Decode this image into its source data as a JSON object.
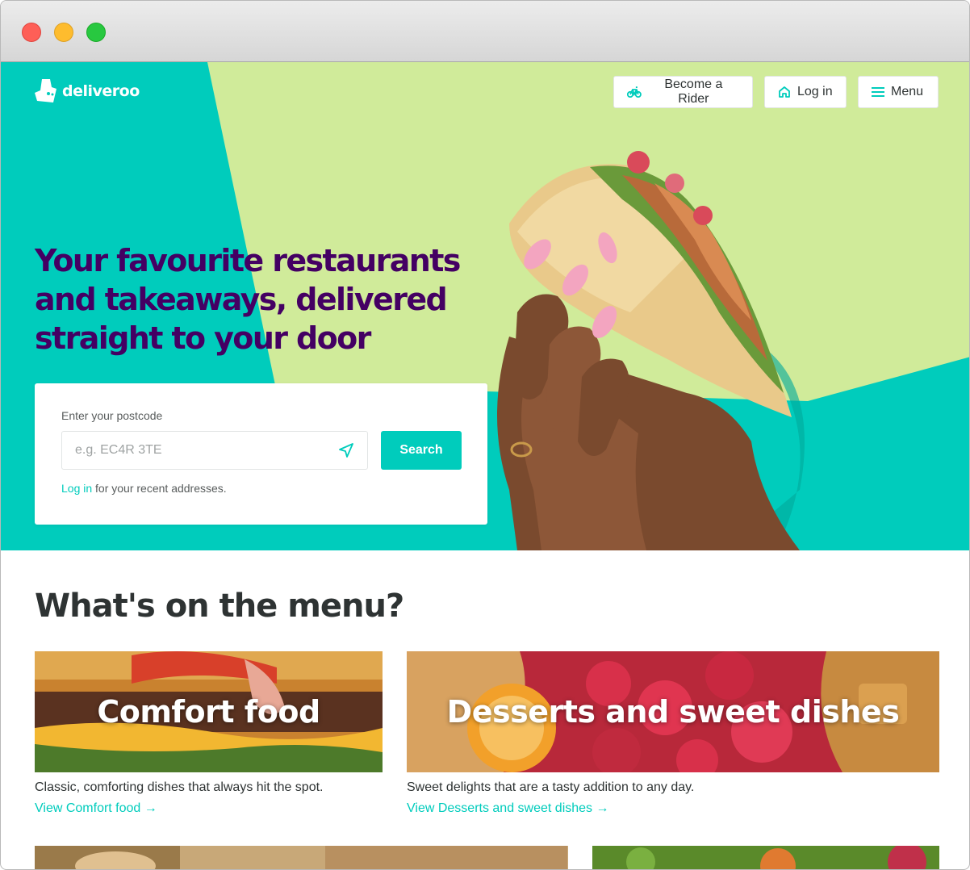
{
  "brand": {
    "name": "deliveroo",
    "teal": "#00ccbc",
    "purple": "#440063",
    "lime": "#d0eb9a"
  },
  "nav": {
    "rider_label": "Become a Rider",
    "login_label": "Log in",
    "menu_label": "Menu"
  },
  "hero": {
    "headline": "Your favourite restaurants and takeaways, delivered straight to your door",
    "search": {
      "label": "Enter your postcode",
      "placeholder": "e.g. EC4R 3TE",
      "button_label": "Search",
      "login_link": "Log in",
      "recent_text": " for your recent addresses."
    }
  },
  "menu_section": {
    "title": "What's on the menu?",
    "cards": [
      {
        "title": "Comfort food",
        "description": "Classic, comforting dishes that always hit the spot.",
        "link": "View Comfort food →"
      },
      {
        "title": "Desserts and sweet dishes",
        "description": "Sweet delights that are a tasty addition to any day.",
        "link": "View Desserts and sweet dishes →"
      }
    ]
  },
  "icons": [
    "kangaroo-logo-icon",
    "bicycle-icon",
    "home-icon",
    "hamburger-menu-icon",
    "location-arrow-icon"
  ]
}
